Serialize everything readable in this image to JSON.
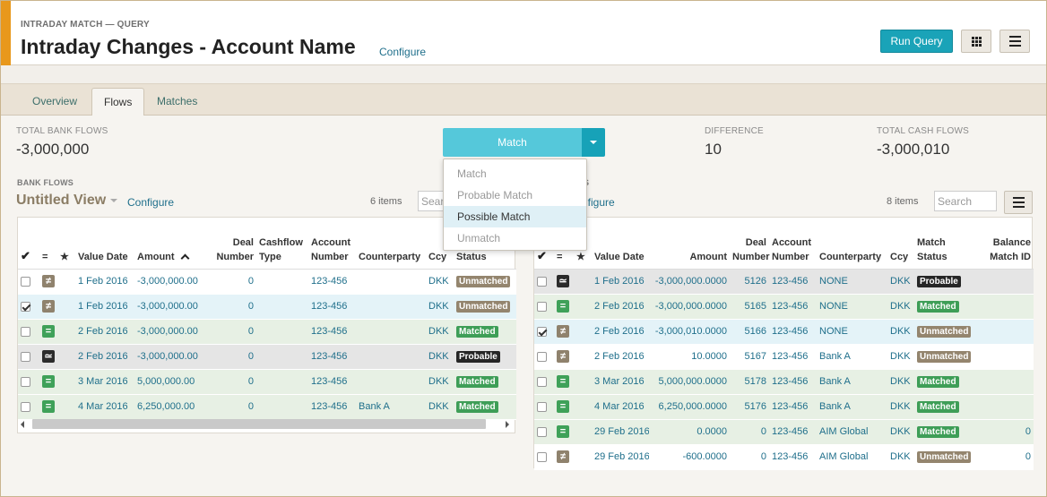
{
  "header": {
    "eyebrow": "INTRADAY MATCH — QUERY",
    "title": "Intraday Changes - Account Name",
    "configure": "Configure",
    "run_query": "Run Query"
  },
  "tabs": [
    {
      "label": "Overview",
      "active": false
    },
    {
      "label": "Flows",
      "active": true
    },
    {
      "label": "Matches",
      "active": false
    }
  ],
  "stats": {
    "bank_label": "TOTAL BANK FLOWS",
    "bank_value": "-3,000,000",
    "diff_label": "DIFFERENCE",
    "diff_value": "10",
    "cash_label": "TOTAL CASH FLOWS",
    "cash_value": "-3,000,010"
  },
  "match_button": {
    "label": "Match",
    "menu": [
      {
        "label": "Match",
        "enabled": false
      },
      {
        "label": "Probable Match",
        "enabled": false
      },
      {
        "label": "Possible Match",
        "enabled": true,
        "highlighted": true
      },
      {
        "label": "Unmatch",
        "enabled": false
      }
    ]
  },
  "bank_flows": {
    "section_label": "BANK FLOWS",
    "view_title": "Untitled View",
    "configure": "Configure",
    "items_count": "6 items",
    "search_placeholder": "Search",
    "columns": [
      "=",
      "★",
      "Value Date",
      "Amount",
      "Deal Number",
      "Cashflow Type",
      "Account Number",
      "Counterparty",
      "Ccy",
      "Match Status"
    ],
    "rows": [
      {
        "checked": false,
        "icon": "neq",
        "date": "1 Feb 2016",
        "amount": "-3,000,000.00",
        "deal": "0",
        "cashflow": "",
        "account": "123-456",
        "counterparty": "",
        "ccy": "DKK",
        "status": "Unmatched"
      },
      {
        "checked": true,
        "icon": "neq",
        "date": "1 Feb 2016",
        "amount": "-3,000,000.00",
        "deal": "0",
        "cashflow": "",
        "account": "123-456",
        "counterparty": "",
        "ccy": "DKK",
        "status": "Unmatched"
      },
      {
        "checked": false,
        "icon": "eq",
        "date": "2 Feb 2016",
        "amount": "-3,000,000.00",
        "deal": "0",
        "cashflow": "",
        "account": "123-456",
        "counterparty": "",
        "ccy": "DKK",
        "status": "Matched"
      },
      {
        "checked": false,
        "icon": "approx",
        "date": "2 Feb 2016",
        "amount": "-3,000,000.00",
        "deal": "0",
        "cashflow": "",
        "account": "123-456",
        "counterparty": "",
        "ccy": "DKK",
        "status": "Probable"
      },
      {
        "checked": false,
        "icon": "eq",
        "date": "3 Mar 2016",
        "amount": "5,000,000.00",
        "deal": "0",
        "cashflow": "",
        "account": "123-456",
        "counterparty": "",
        "ccy": "DKK",
        "status": "Matched"
      },
      {
        "checked": false,
        "icon": "eq",
        "date": "4 Mar 2016",
        "amount": "6,250,000.00",
        "deal": "0",
        "cashflow": "",
        "account": "123-456",
        "counterparty": "Bank A",
        "ccy": "DKK",
        "status": "Matched"
      }
    ]
  },
  "cash_flows": {
    "section_label": "S",
    "configure": "nfigure",
    "items_count": "8 items",
    "search_placeholder": "Search",
    "columns": [
      "=",
      "★",
      "Value Date",
      "Amount",
      "Deal Number",
      "Account Number",
      "Counterparty",
      "Ccy",
      "Match Status",
      "Balance Match ID"
    ],
    "rows": [
      {
        "checked": false,
        "icon": "approx",
        "date": "1 Feb 2016",
        "amount": "-3,000,000.0000",
        "deal": "5126",
        "account": "123-456",
        "counterparty": "NONE",
        "ccy": "DKK",
        "status": "Probable",
        "bal": ""
      },
      {
        "checked": false,
        "icon": "eq",
        "date": "2 Feb 2016",
        "amount": "-3,000,000.0000",
        "deal": "5165",
        "account": "123-456",
        "counterparty": "NONE",
        "ccy": "DKK",
        "status": "Matched",
        "bal": ""
      },
      {
        "checked": true,
        "icon": "neq",
        "date": "2 Feb 2016",
        "amount": "-3,000,010.0000",
        "deal": "5166",
        "account": "123-456",
        "counterparty": "NONE",
        "ccy": "DKK",
        "status": "Unmatched",
        "bal": ""
      },
      {
        "checked": false,
        "icon": "neq",
        "date": "2 Feb 2016",
        "amount": "10.0000",
        "deal": "5167",
        "account": "123-456",
        "counterparty": "Bank A",
        "ccy": "DKK",
        "status": "Unmatched",
        "bal": ""
      },
      {
        "checked": false,
        "icon": "eq",
        "date": "3 Mar 2016",
        "amount": "5,000,000.0000",
        "deal": "5178",
        "account": "123-456",
        "counterparty": "Bank A",
        "ccy": "DKK",
        "status": "Matched",
        "bal": ""
      },
      {
        "checked": false,
        "icon": "eq",
        "date": "4 Mar 2016",
        "amount": "6,250,000.0000",
        "deal": "5176",
        "account": "123-456",
        "counterparty": "Bank A",
        "ccy": "DKK",
        "status": "Matched",
        "bal": ""
      },
      {
        "checked": false,
        "icon": "eq",
        "date": "29 Feb 2016",
        "amount": "0.0000",
        "deal": "0",
        "account": "123-456",
        "counterparty": "AIM Global",
        "ccy": "DKK",
        "status": "Matched",
        "bal": "0"
      },
      {
        "checked": false,
        "icon": "neq",
        "date": "29 Feb 2016",
        "amount": "-600.0000",
        "deal": "0",
        "account": "123-456",
        "counterparty": "AIM Global",
        "ccy": "DKK",
        "status": "Unmatched",
        "bal": "0"
      }
    ]
  },
  "icons": {
    "neq": "≠",
    "eq": "=",
    "approx": "≃"
  },
  "colors": {
    "accent": "#e8981c",
    "primary": "#1aa3b8",
    "matched": "#3e9e57",
    "unmatched": "#94856e",
    "probable": "#262626"
  }
}
